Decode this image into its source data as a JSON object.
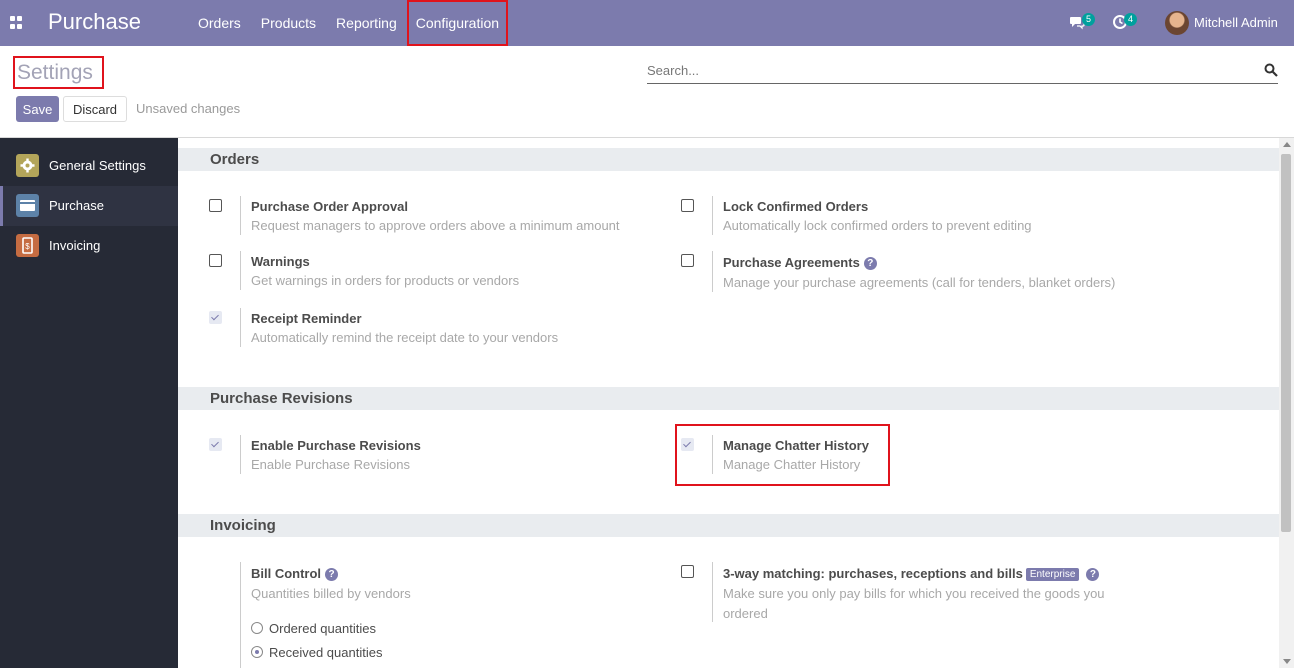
{
  "topbar": {
    "brand": "Purchase",
    "menu": [
      {
        "label": "Orders"
      },
      {
        "label": "Products"
      },
      {
        "label": "Reporting"
      },
      {
        "label": "Configuration"
      }
    ],
    "messages_count": "5",
    "activities_count": "4",
    "user_name": "Mitchell Admin",
    "bg_color": "#7c7bad"
  },
  "control_panel": {
    "title": "Settings",
    "search_placeholder": "Search...",
    "save_label": "Save",
    "discard_label": "Discard",
    "status": "Unsaved changes"
  },
  "sidebar": {
    "items": [
      {
        "label": "General Settings",
        "icon": "gear-icon"
      },
      {
        "label": "Purchase",
        "icon": "purchase-icon",
        "active": true
      },
      {
        "label": "Invoicing",
        "icon": "invoicing-icon"
      }
    ]
  },
  "sections": {
    "orders": {
      "title": "Orders",
      "settings": [
        {
          "title": "Purchase Order Approval",
          "desc": "Request managers to approve orders above a minimum amount",
          "checked": false
        },
        {
          "title": "Lock Confirmed Orders",
          "desc": "Automatically lock confirmed orders to prevent editing",
          "checked": false
        },
        {
          "title": "Warnings",
          "desc": "Get warnings in orders for products or vendors",
          "checked": false
        },
        {
          "title": "Purchase Agreements",
          "desc": "Manage your purchase agreements (call for tenders, blanket orders)",
          "checked": false
        },
        {
          "title": "Receipt Reminder",
          "desc": "Automatically remind the receipt date to your vendors",
          "checked": true
        }
      ]
    },
    "revisions": {
      "title": "Purchase Revisions",
      "settings": [
        {
          "title": "Enable Purchase Revisions",
          "desc": "Enable Purchase Revisions",
          "checked": true
        },
        {
          "title": "Manage Chatter History",
          "desc": "Manage Chatter History",
          "checked": true
        }
      ]
    },
    "invoicing": {
      "title": "Invoicing",
      "bill_control": {
        "title": "Bill Control",
        "desc": "Quantities billed by vendors",
        "options": [
          {
            "label": "Ordered quantities",
            "selected": false
          },
          {
            "label": "Received quantities",
            "selected": true
          }
        ]
      },
      "three_way": {
        "title": "3-way matching: purchases, receptions and bills",
        "badge": "Enterprise",
        "desc_line1": "Make sure you only pay bills for which you received the goods you",
        "desc_line2": "ordered",
        "checked": false
      }
    }
  }
}
